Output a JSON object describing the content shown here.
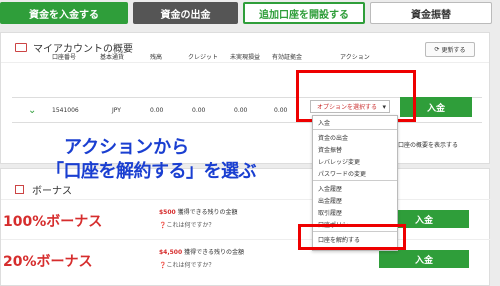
{
  "tabs": [
    {
      "label": "資金を入金する"
    },
    {
      "label": "資金の出金"
    },
    {
      "label": "追加口座を開設する"
    },
    {
      "label": "資金振替"
    }
  ],
  "account_panel": {
    "title": "マイアカウントの概要",
    "refresh_label": "更新する",
    "columns": [
      "口座番号",
      "基本通貨",
      "残高",
      "クレジット",
      "未実現損益",
      "有効証拠金",
      "アクション"
    ],
    "row": {
      "account_number": "1541006",
      "currency": "JPY",
      "balance": "0.00",
      "credit": "0.00",
      "unrealized": "0.00",
      "equity": "0.00"
    },
    "select_placeholder": "オプションを選択する",
    "deposit_label": "入金",
    "summary_link": "全口座の概要を表示する"
  },
  "annotation": {
    "line1": "アクションから",
    "line2": "「口座を解約する」を選ぶ"
  },
  "dropdown": {
    "items": [
      "入金",
      "資金の出金",
      "資金振替",
      "レバレッジ変更",
      "パスワードの変更",
      "入金履歴",
      "出金履歴",
      "取引履歴",
      "口座ポリシー",
      "口座を解約する"
    ]
  },
  "bonus": {
    "title": "ボーナス",
    "rows": [
      {
        "name": "100%ボーナス",
        "amount": "$500",
        "amount_text": " 獲得できる残りの金額",
        "question": "❓これは何ですか？",
        "deposit_label": "入金"
      },
      {
        "name": "20%ボーナス",
        "amount": "$4,500",
        "amount_text": " 獲得できる残りの金額",
        "question": "❓これは何ですか？",
        "deposit_label": "入金"
      }
    ]
  }
}
